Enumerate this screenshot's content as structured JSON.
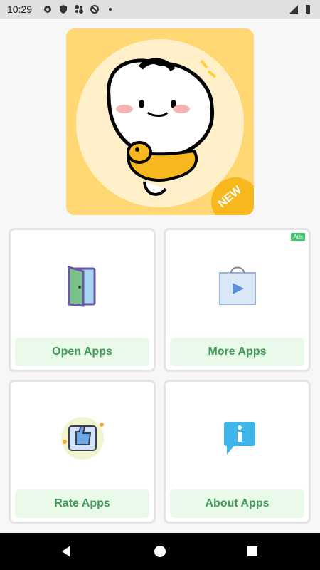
{
  "status_bar": {
    "time": "10:29",
    "left_icons": [
      "gear-icon",
      "shield-icon",
      "fan-icon",
      "sync-icon",
      "dot-icon"
    ],
    "right_icons": [
      "signal-icon",
      "battery-icon"
    ]
  },
  "banner": {
    "badge": "NEW",
    "colors": {
      "background": "#ffd873",
      "circle": "#fff0c9",
      "badge": "#f7b81e"
    }
  },
  "cards": [
    {
      "label": "Open Apps",
      "icon": "door-icon"
    },
    {
      "label": "More Apps",
      "icon": "play-store-bag-icon",
      "badge": "Ads"
    },
    {
      "label": "Rate Apps",
      "icon": "thumbs-up-icon"
    },
    {
      "label": "About Apps",
      "icon": "info-chat-icon"
    }
  ],
  "colors": {
    "button_bg": "#eafaea",
    "button_text": "#3f9b57",
    "ads_badge": "#3ec36a"
  },
  "nav_bar": {
    "buttons": [
      "back-icon",
      "home-icon",
      "recents-icon"
    ]
  }
}
